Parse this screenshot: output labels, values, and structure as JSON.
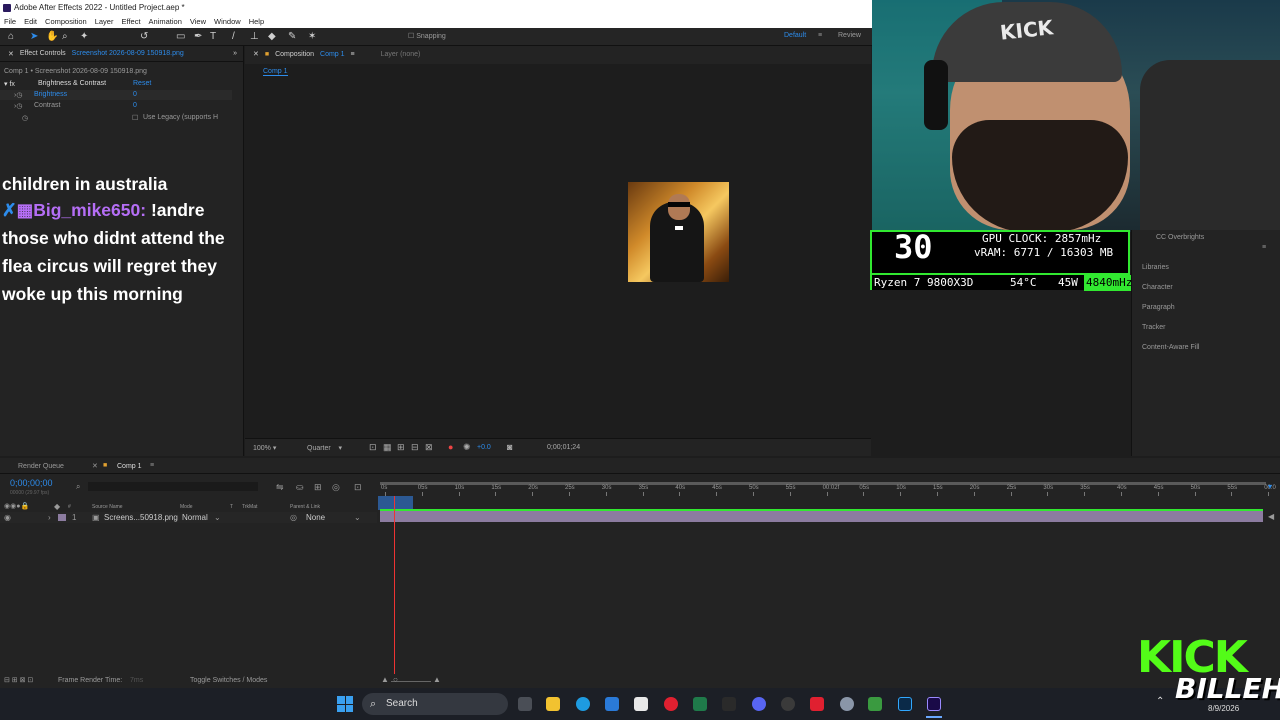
{
  "window": {
    "title": "Adobe After Effects 2022 - Untitled Project.aep *"
  },
  "menu": [
    "File",
    "Edit",
    "Composition",
    "Layer",
    "Effect",
    "Animation",
    "View",
    "Window",
    "Help"
  ],
  "toolbar": {
    "snapping": "Snapping",
    "workspace_default": "Default",
    "workspace_review": "Review"
  },
  "effect_controls": {
    "tab_label": "Effect Controls",
    "tab_file": "Screenshot 2026-08-09 150918.png",
    "breadcrumb": "Comp 1 • Screenshot 2026-08-09 150918.png",
    "effect_name": "Brightness & Contrast",
    "reset": "Reset",
    "params": [
      {
        "name": "Brightness",
        "value": "0"
      },
      {
        "name": "Contrast",
        "value": "0"
      }
    ],
    "legacy": "Use Legacy (supports H"
  },
  "chat": {
    "prev_line": "children in australia",
    "user": "Big_mike650:",
    "message_lines": [
      "!andre",
      "those who didnt attend the",
      "flea circus will regret they",
      "woke up this morning"
    ]
  },
  "composition": {
    "tab_label": "Composition",
    "tab_name": "Comp 1",
    "layer_label": "Layer (none)",
    "sub_tab": "Comp 1",
    "zoom": "100%",
    "resolution": "Quarter",
    "exposure": "+0.0",
    "time": "0;00;01;24"
  },
  "stats": {
    "fps": "30",
    "gpu_clock": "GPU CLOCK: 2857mHz",
    "vram": "vRAM: 6771 / 16303 MB",
    "cpu": "Ryzen 7 9800X3D",
    "temp": "54°C",
    "power": "45W",
    "mhz": "4840mHz"
  },
  "webcam": {
    "cap_text": "KICK"
  },
  "right_panel": {
    "header": "CC Overbrights",
    "items": [
      "Libraries",
      "Character",
      "Paragraph",
      "Tracker",
      "Content-Aware Fill"
    ]
  },
  "timeline": {
    "render_queue": "Render Queue",
    "comp_tab": "Comp 1",
    "timecode": "0;00;00;00",
    "fps_note": "00000 (29.97 fps)",
    "columns": [
      "Source Name",
      "Mode",
      "T",
      "TrkMat",
      "Parent & Link"
    ],
    "layer": {
      "index": "1",
      "name": "Screens...50918.png",
      "mode": "Normal",
      "parent": "None"
    },
    "ticks": [
      "0s",
      "05s",
      "10s",
      "15s",
      "20s",
      "25s",
      "30s",
      "35s",
      "40s",
      "45s",
      "50s",
      "55s",
      "00:02f",
      "05s",
      "10s",
      "15s",
      "20s",
      "25s",
      "30s",
      "35s",
      "40s",
      "45s",
      "50s",
      "55s",
      "00:0"
    ],
    "status_label": "Frame Render Time:",
    "status_value": "7ms",
    "toggle": "Toggle Switches / Modes"
  },
  "taskbar": {
    "search": "Search",
    "date": "8/9/2026"
  },
  "overlay": {
    "kick": "KICK",
    "billeh": "BILLEH"
  }
}
